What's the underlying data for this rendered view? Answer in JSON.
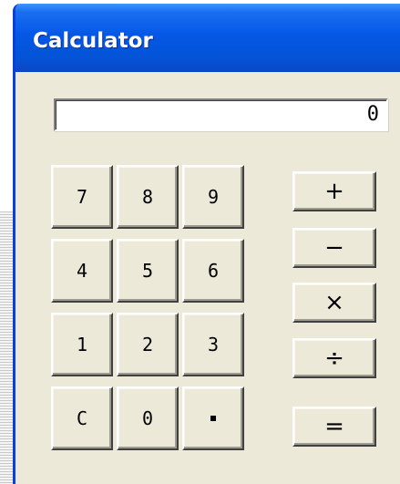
{
  "window": {
    "title": "Calculator"
  },
  "display": {
    "value": "0"
  },
  "keypad": {
    "rows": [
      [
        "7",
        "8",
        "9"
      ],
      [
        "4",
        "5",
        "6"
      ],
      [
        "1",
        "2",
        "3"
      ],
      [
        "C",
        "0",
        "."
      ]
    ]
  },
  "operators": {
    "add": "+",
    "subtract": "−",
    "multiply": "×",
    "divide": "÷",
    "equals": "="
  },
  "colors": {
    "titlebar": "#0558e6",
    "window_face": "#ece9d8",
    "display_bg": "#ffffff"
  }
}
